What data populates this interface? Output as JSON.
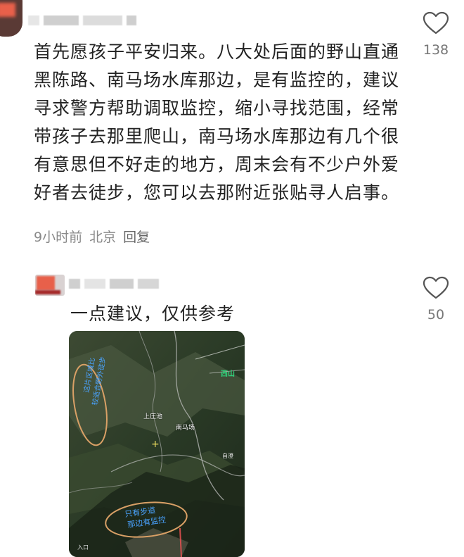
{
  "comments": [
    {
      "text": "首先愿孩子平安归来。八大处后面的野山直通黑陈路、南马场水库那边，是有监控的，建议寻求警方帮助调取监控，缩小寻找范围，经常带孩子去那里爬山，南马场水库那边有几个很有意思但不好走的地方，周末会有不少户外爱好者去徒步，您可以去那附近张贴寻人启事。",
      "time": "9小时前",
      "location": "北京",
      "reply_label": "回复",
      "likes": "138",
      "like_icon": "heart-outline-icon"
    },
    {
      "text": "一点建议，仅供参考",
      "likes": "50",
      "like_icon": "heart-outline-icon",
      "map": {
        "labels": {
          "place1": "上庄池",
          "place2": "南马场",
          "pin": "西山",
          "poi1": "自澄",
          "poi2": "入口"
        },
        "annotation_top": [
          "这片区域比",
          "较适合野外徒步"
        ],
        "annotation_bottom": [
          "只有步道",
          "那边有监控"
        ]
      }
    }
  ],
  "colors": {
    "text": "#222222",
    "meta": "#8a8a8a",
    "like_count": "#777777",
    "annotation_outline": "#d9a066",
    "annotation_text": "#4aa3ff"
  }
}
